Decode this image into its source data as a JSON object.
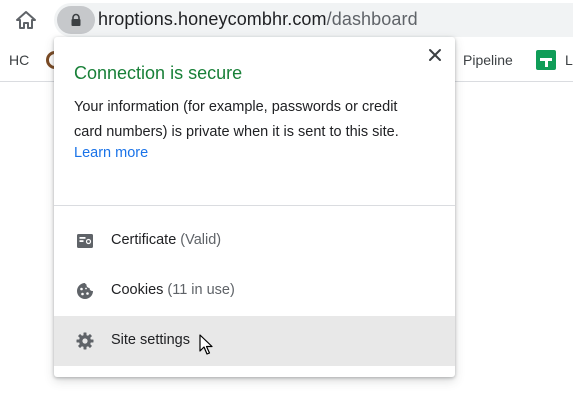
{
  "toolbar": {
    "home_icon": "home-icon",
    "lock_icon": "lock-icon",
    "url_host": "hroptions.honeycombhr.com",
    "url_path": "/dashboard"
  },
  "bookmarks": {
    "items": [
      {
        "label": "HC"
      },
      {
        "label": "Pipeline"
      },
      {
        "label": "L"
      }
    ]
  },
  "popup": {
    "title": "Connection is secure",
    "description": "Your information (for example, passwords or credit card numbers) is private when it is sent to this site.",
    "learn_more": "Learn more",
    "title_color": "#188038",
    "link_color": "#1a73e8",
    "rows": [
      {
        "label": "Certificate",
        "detail": "(Valid)",
        "icon": "certificate-icon"
      },
      {
        "label": "Cookies",
        "detail": "(11 in use)",
        "icon": "cookie-icon"
      },
      {
        "label": "Site settings",
        "detail": "",
        "icon": "gear-icon"
      }
    ]
  }
}
